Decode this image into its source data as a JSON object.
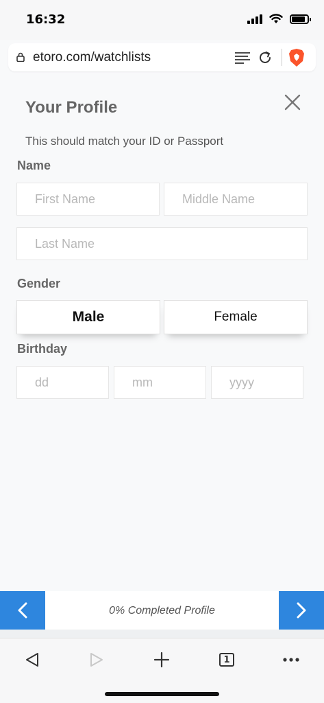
{
  "status_bar": {
    "time": "16:32",
    "signal_icon": "cellular-signal-icon",
    "wifi_icon": "wifi-icon",
    "battery_icon": "battery-icon"
  },
  "browser": {
    "url": "etoro.com/watchlists",
    "icons": [
      "lock-icon",
      "reader-mode-icon",
      "reload-icon",
      "brave-shield-icon"
    ]
  },
  "form": {
    "title": "Your Profile",
    "subtitle": "This should match your ID or Passport",
    "name_section": {
      "label": "Name",
      "first_name": {
        "value": "",
        "placeholder": "First Name"
      },
      "middle_name": {
        "value": "",
        "placeholder": "Middle Name"
      },
      "last_name": {
        "value": "",
        "placeholder": "Last Name"
      }
    },
    "gender_section": {
      "label": "Gender",
      "options": [
        "Male",
        "Female"
      ],
      "selected": "Male"
    },
    "birthday_section": {
      "label": "Birthday",
      "day": {
        "value": "",
        "placeholder": "dd"
      },
      "month": {
        "value": "",
        "placeholder": "mm"
      },
      "year": {
        "value": "",
        "placeholder": "yyyy"
      }
    }
  },
  "progress": {
    "text": "0% Completed Profile",
    "percent": 0
  },
  "colors": {
    "accent": "#2e86de",
    "background": "#f8f9fa",
    "brave": "#fb542b"
  }
}
